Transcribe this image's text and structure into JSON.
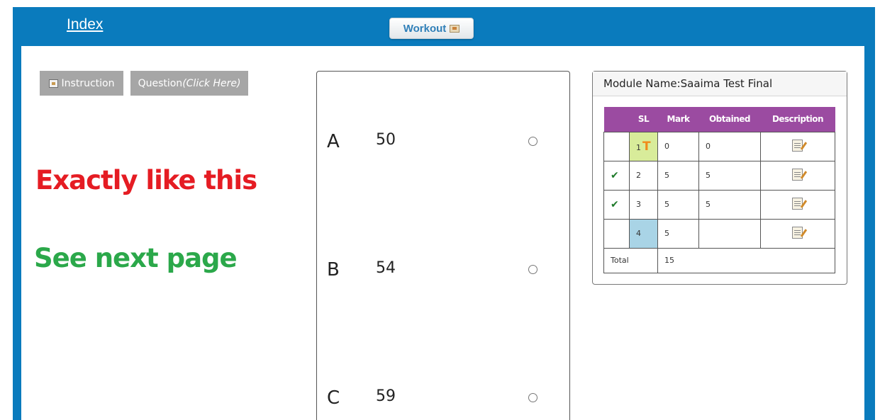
{
  "header": {
    "index_label": "Index",
    "workout_label": "Workout",
    "workout_icon": "report-icon",
    "bar_color": "#0a7bbd"
  },
  "tabs": {
    "instruction_label": "Instruction",
    "question_label": "Question",
    "question_hint": "(Click Here)"
  },
  "notes": {
    "red_text": "Exactly like this",
    "green_text": "See next page"
  },
  "options": [
    {
      "letter": "A",
      "value": "50"
    },
    {
      "letter": "B",
      "value": "54"
    },
    {
      "letter": "C",
      "value": "59"
    }
  ],
  "module": {
    "title": "Module Name:Saaima Test Final",
    "columns": [
      "SL",
      "Mark",
      "Obtained",
      "Description"
    ],
    "rows": [
      {
        "check": "",
        "sl": "1",
        "flag": "T",
        "mark": "0",
        "obtained": "0"
      },
      {
        "check": "✔",
        "sl": "2",
        "flag": "",
        "mark": "5",
        "obtained": "5"
      },
      {
        "check": "✔",
        "sl": "3",
        "flag": "",
        "mark": "5",
        "obtained": "5"
      },
      {
        "check": "",
        "sl": "4",
        "flag": "",
        "mark": "5",
        "obtained": ""
      }
    ],
    "total_label": "Total",
    "total_value": "15",
    "header_color": "#9b4ba1"
  }
}
